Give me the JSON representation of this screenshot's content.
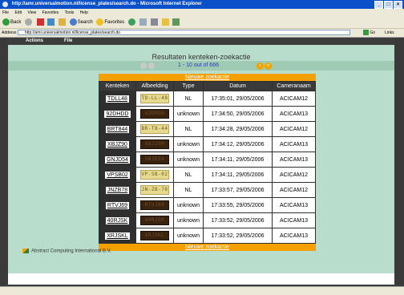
{
  "window": {
    "title": "http://amr.universalmotion.nl/license_plates/search.do - Microsoft Internet Explorer"
  },
  "menu": [
    "File",
    "Edit",
    "View",
    "Favorites",
    "Tools",
    "Help"
  ],
  "toolbar": {
    "back": "Back",
    "search": "Search",
    "favorites": "Favorites"
  },
  "address": {
    "label": "Address",
    "url": "http://amr.universalmotion.nl/license_plates/search.do",
    "go": "Go",
    "links": "Links"
  },
  "nav": {
    "actions": "Actions",
    "file": "File"
  },
  "page": {
    "heading": "Resultaten kenteken-zoekactie",
    "paging": "1 - 10 out of 666",
    "new_search": "Nieuwe zoekactie",
    "footer": "Abstract Computing International B.V."
  },
  "columns": [
    "Kenteken",
    "Afbeelding",
    "Type",
    "Datum",
    "Cameranaam"
  ],
  "rows": [
    {
      "plate": "TDLL48",
      "img": "TD-LL-48",
      "style": "light",
      "type": "NL",
      "date": "17:35:01, 29/05/2006",
      "camera": "ACICAM12"
    },
    {
      "plate": "92DHDD",
      "img": "92DHDD",
      "style": "dark",
      "type": "unknown",
      "date": "17:34:50, 29/05/2006",
      "camera": "ACICAM13"
    },
    {
      "plate": "BRT844",
      "img": "BR-T8-44",
      "style": "light",
      "type": "NL",
      "date": "17:34:28, 29/05/2006",
      "camera": "ACICAM12"
    },
    {
      "plate": "XBJZ90",
      "img": "XBJZ90",
      "style": "dark",
      "type": "unknown",
      "date": "17:34:12, 29/05/2006",
      "camera": "ACICAM13"
    },
    {
      "plate": "GNJD54",
      "img": "GNJD54",
      "style": "dark",
      "type": "unknown",
      "date": "17:34:11, 29/05/2006",
      "camera": "ACICAM13"
    },
    {
      "plate": "VPSB02",
      "img": "VP-SB-02",
      "style": "light",
      "type": "NL",
      "date": "17:34:11, 29/05/2006",
      "camera": "ACICAM12"
    },
    {
      "plate": "JNZB78",
      "img": "JN-ZB-78",
      "style": "light",
      "type": "NL",
      "date": "17:33:57, 29/05/2006",
      "camera": "ACICAM12"
    },
    {
      "plate": "RTVJ69",
      "img": "RTVJ69",
      "style": "dark",
      "type": "unknown",
      "date": "17:33:55, 29/05/2006",
      "camera": "ACICAM13"
    },
    {
      "plate": "40RJSK",
      "img": "40RJSK",
      "style": "dark",
      "type": "unknown",
      "date": "17:33:52, 29/05/2006",
      "camera": "ACICAM13"
    },
    {
      "plate": "XRJSKL",
      "img": "XRJSKL",
      "style": "dark",
      "type": "unknown",
      "date": "17:33:52, 29/05/2006",
      "camera": "ACICAM13"
    }
  ]
}
